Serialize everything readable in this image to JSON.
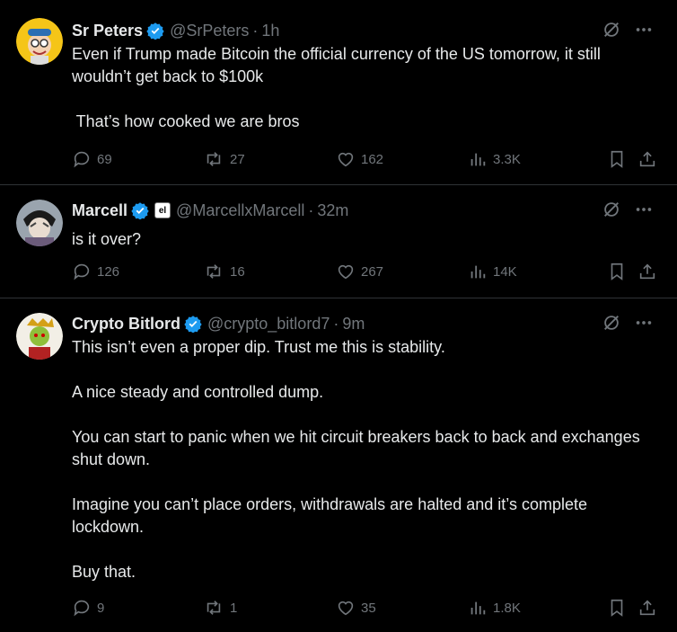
{
  "tweets": [
    {
      "name": "Sr Peters",
      "handle": "@SrPeters",
      "sep": "·",
      "time": "1h",
      "paragraphs": [
        "Even if Trump made Bitcoin the official currency of the US tomorrow, it still wouldn’t get back to $100k",
        " That’s how cooked we are bros"
      ],
      "stats": {
        "replies": "69",
        "reposts": "27",
        "likes": "162",
        "views": "3.3K"
      }
    },
    {
      "name": "Marcell",
      "affiliate_badge": "el",
      "handle": "@MarcellxMarcell",
      "sep": "·",
      "time": "32m",
      "paragraphs": [
        "is it over?"
      ],
      "stats": {
        "replies": "126",
        "reposts": "16",
        "likes": "267",
        "views": "14K"
      }
    },
    {
      "name": "Crypto Bitlord",
      "handle": "@crypto_bitlord7",
      "sep": "·",
      "time": "9m",
      "paragraphs": [
        "This isn’t even a proper dip. Trust me this is stability.",
        "A nice steady and controlled dump.",
        "You can start to panic when we hit circuit breakers back to back and exchanges shut down.",
        "Imagine you can’t place orders, withdrawals are halted and it’s complete lockdown.",
        "Buy that."
      ],
      "stats": {
        "replies": "9",
        "reposts": "1",
        "likes": "35",
        "views": "1.8K"
      }
    }
  ],
  "icons": [
    "verified-badge-icon",
    "grok-icon",
    "more-icon",
    "reply-icon",
    "repost-icon",
    "like-icon",
    "views-icon",
    "bookmark-icon",
    "share-icon"
  ],
  "colors": {
    "background": "#000000",
    "text": "#e7e9ea",
    "muted": "#71767b",
    "verified": "#1d9bf0",
    "divider": "#2f3336"
  }
}
